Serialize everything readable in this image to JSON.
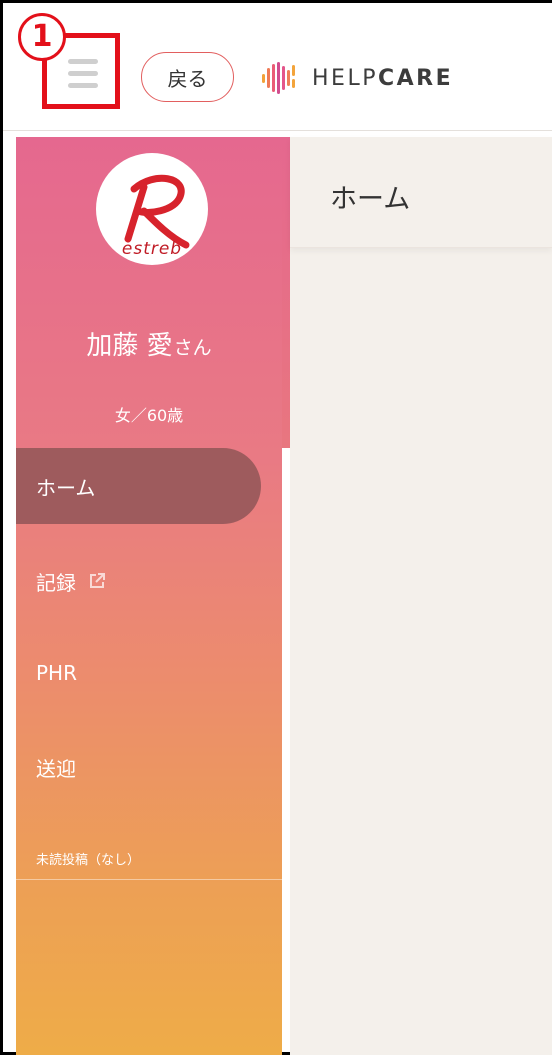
{
  "header": {
    "step_number": "1",
    "back_label": "戻る",
    "logo_text_light": "HELP",
    "logo_text_bold": "CARE"
  },
  "sidebar": {
    "avatar_caption": "estreb",
    "user_name": "加藤 愛",
    "user_suffix": "さん",
    "user_meta": "女／60歳",
    "items": [
      {
        "label": "ホーム",
        "active": true,
        "icon": ""
      },
      {
        "label": "記録",
        "active": false,
        "icon": "external-link-icon"
      },
      {
        "label": "PHR",
        "active": false,
        "icon": ""
      },
      {
        "label": "送迎",
        "active": false,
        "icon": ""
      }
    ],
    "unread_label": "未読投稿（なし）"
  },
  "main": {
    "page_title": "ホーム"
  },
  "colors": {
    "accent_red": "#e3101a",
    "sidebar_top": "#e5688f",
    "sidebar_bottom": "#eeac48",
    "active_item": "#9e5b5d",
    "main_bg": "#f4f0eb"
  }
}
